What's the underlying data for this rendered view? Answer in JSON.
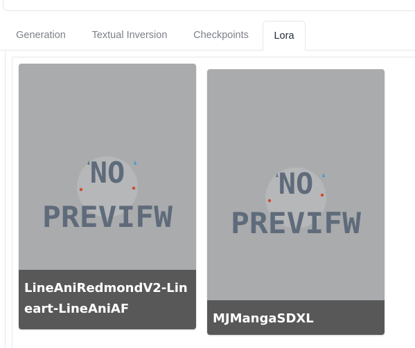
{
  "tabs": [
    {
      "label": "Generation"
    },
    {
      "label": "Textual Inversion"
    },
    {
      "label": "Checkpoints"
    },
    {
      "label": "Lora"
    }
  ],
  "selected_tab": "Lora",
  "cards": [
    {
      "name": "LineAniRedmondV2-Lineart-LineAniAF",
      "preview_text": [
        "NO",
        "PREVIFW"
      ]
    },
    {
      "name": "MJMangaSDXL",
      "preview_text": [
        "NO",
        "PREVIFW"
      ]
    }
  ],
  "colors": {
    "card_bg": "#a9abad",
    "caption_bg": "#585858",
    "placeholder_text": "#5f6b7a",
    "placeholder_circle": "#b5b7b9"
  }
}
